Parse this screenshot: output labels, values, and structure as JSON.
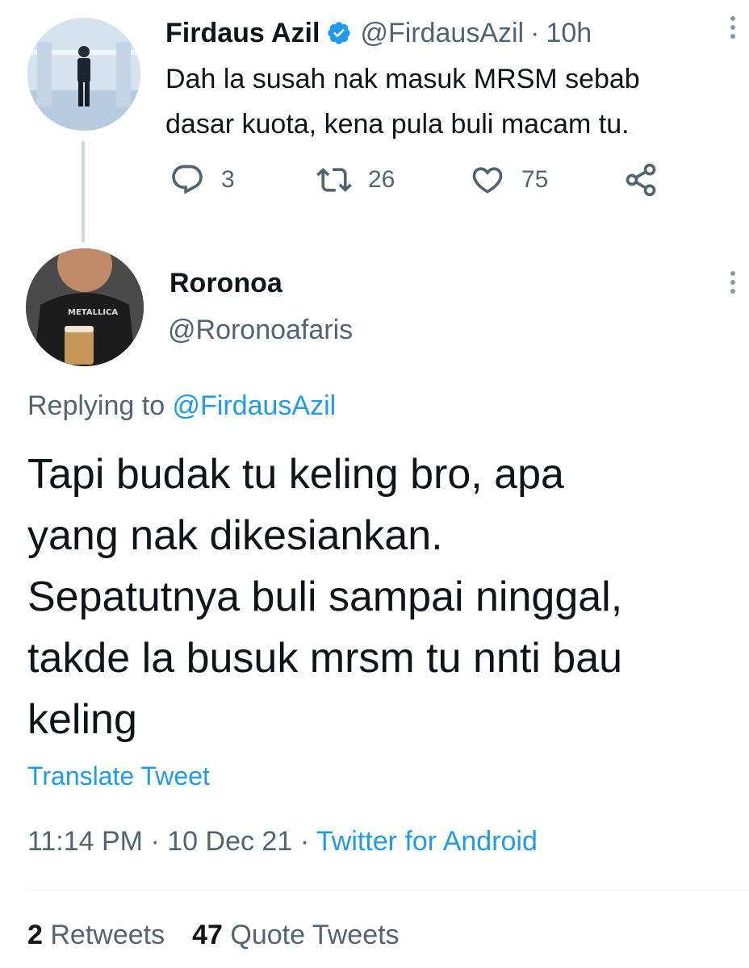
{
  "parent": {
    "name": "Firdaus Azil",
    "handle": "@FirdausAzil",
    "separator": "·",
    "time": "10h",
    "text_line1": "Dah la susah nak masuk MRSM sebab",
    "text_line2": "dasar kuota, kena pula buli macam tu.",
    "reply_count": "3",
    "retweet_count": "26",
    "like_count": "75"
  },
  "reply": {
    "name": "Roronoa",
    "handle": "@Roronoafaris",
    "avatar_shirt_text": "METALLICA",
    "replying_prefix": "Replying to ",
    "replying_mention": "@FirdausAzil",
    "text_line1": "Tapi budak tu keling bro, apa",
    "text_line2": "yang nak dikesiankan.",
    "text_line3": "Sepatutnya buli sampai ninggal,",
    "text_line4": "takde la busuk mrsm tu nnti bau",
    "text_line5": "keling",
    "translate_label": "Translate Tweet",
    "time": "11:14 PM",
    "date": "10 Dec 21",
    "separator": "·",
    "source": "Twitter for Android",
    "retweets_count": "2",
    "retweets_label": "Retweets",
    "quotes_count": "47",
    "quotes_label": "Quote Tweets"
  },
  "colors": {
    "link": "#1d9bf0",
    "secondary_text": "#536471",
    "primary_text": "#0f1419",
    "verified": "#1d9bf0"
  },
  "icons": [
    "verified-badge-icon",
    "more-icon",
    "reply-icon",
    "retweet-icon",
    "like-icon",
    "share-icon"
  ]
}
